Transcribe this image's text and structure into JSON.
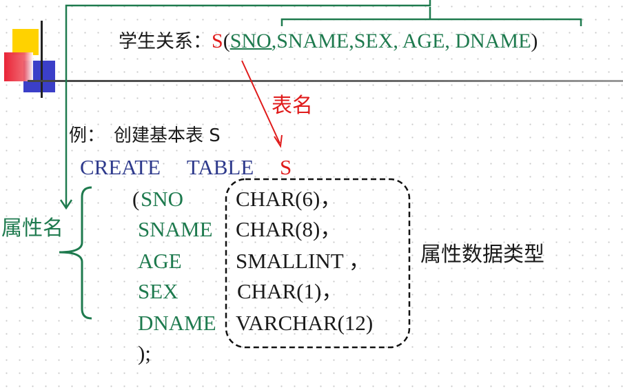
{
  "relation": {
    "prefix": "学生关系：",
    "name": "S",
    "open": "(",
    "key": "SNO,",
    "rest": "SNAME,SEX, AGE, DNAME",
    "close": ")"
  },
  "annotations": {
    "table_name": "表名",
    "attribute_name": "属性名",
    "attribute_type": "属性数据类型"
  },
  "example": {
    "label": "例：",
    "text": "创建基本表 S"
  },
  "sql": {
    "create": "CREATE",
    "table": "TABLE",
    "name": "S",
    "open_paren": "(",
    "close": ");",
    "columns": [
      {
        "name": "SNO",
        "type": "CHAR(6)，"
      },
      {
        "name": "SNAME",
        "type": "CHAR(8)，"
      },
      {
        "name": "AGE",
        "type": "SMALLINT ，"
      },
      {
        "name": "SEX",
        "type": "CHAR(1)，"
      },
      {
        "name": "DNAME",
        "type": "VARCHAR(12)"
      }
    ]
  },
  "colors": {
    "green": "#1e7a4e",
    "red": "#e01b1b",
    "blue": "#2e3a8c",
    "deco_yellow": "#ffd200",
    "deco_red": "#e8192c",
    "deco_blue": "#3b3fc8"
  }
}
